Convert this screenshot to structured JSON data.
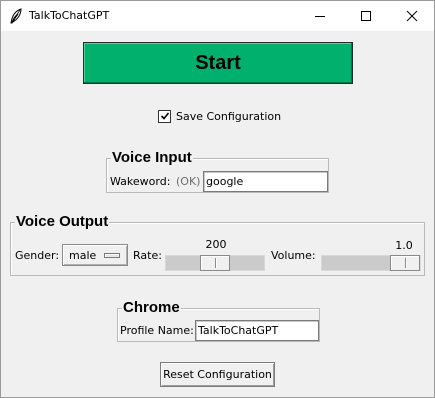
{
  "window": {
    "title": "TalkToChatGPT",
    "app_icon": "feather-icon",
    "controls": [
      "minimize-icon",
      "maximize-icon",
      "close-icon"
    ]
  },
  "start_button": {
    "label": "Start",
    "color": "#00b06c"
  },
  "save_config": {
    "label": "Save Configuration",
    "checked": true
  },
  "voice_input": {
    "legend": "Voice Input",
    "wakeword_label": "Wakeword:",
    "status": "(OK)",
    "wakeword_value": "google"
  },
  "voice_output": {
    "legend": "Voice Output",
    "gender_label": "Gender:",
    "gender_value": "male",
    "rate_label": "Rate:",
    "rate_value": "200",
    "volume_label": "Volume:",
    "volume_value": "1.0"
  },
  "chrome": {
    "legend": "Chrome",
    "profile_label": "Profile Name:",
    "profile_value": "TalkToChatGPT"
  },
  "reset_button": {
    "label": "Reset Configuration"
  }
}
